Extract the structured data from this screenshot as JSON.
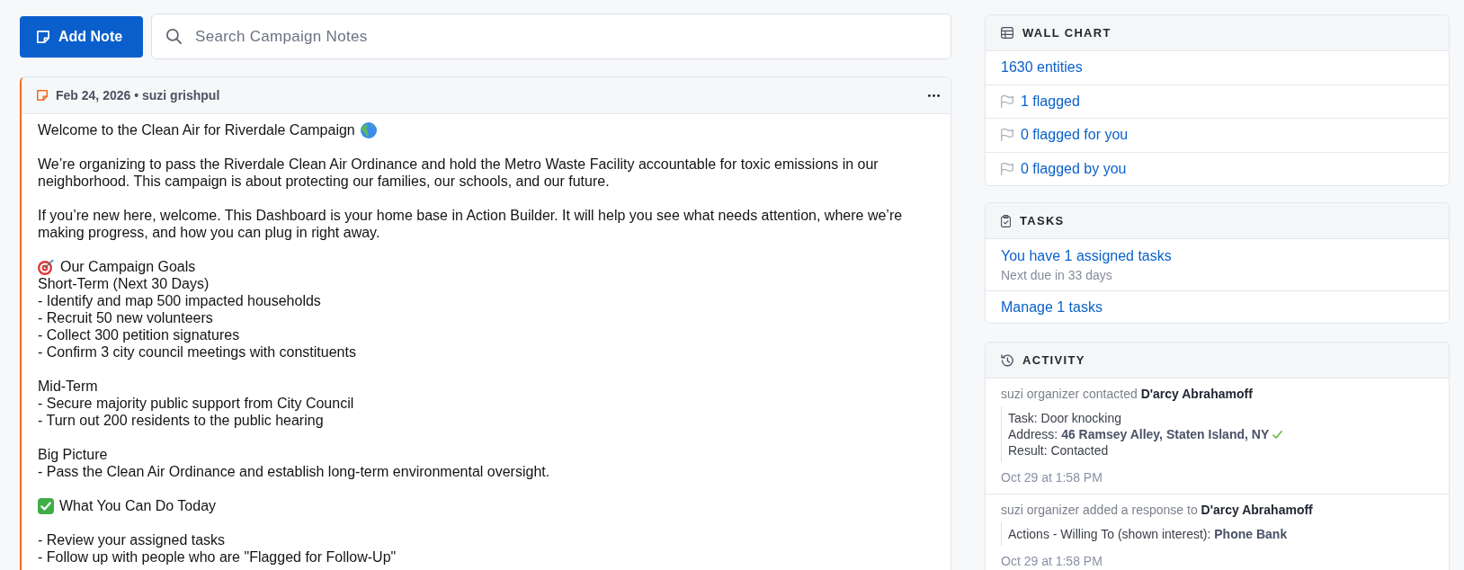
{
  "toolbar": {
    "add_button": "Add Note",
    "search": {
      "placeholder": "Search Campaign Notes"
    }
  },
  "note": {
    "meta": "Feb 24, 2026 • suzi grishpul",
    "blocks": [
      {
        "kind": "title",
        "lines": [
          "Welcome to the Clean Air for Riverdale Campaign"
        ]
      },
      {
        "kind": "text",
        "lines": [
          "We’re organizing to pass the Riverdale Clean Air Ordinance and hold the Metro Waste Facility accountable for toxic emissions in our neighborhood. This campaign is about protecting our families, our schools, and our future."
        ]
      },
      {
        "kind": "text",
        "lines": [
          "If you’re new here, welcome. This Dashboard is your home base in Action Builder. It will help you see what needs attention, where we’re making progress, and how you can plug in right away."
        ]
      },
      {
        "kind": "goals",
        "lines": [
          "Our Campaign Goals",
          "Short-Term (Next 30 Days)",
          "- Identify and map 500 impacted households",
          "- Recruit 50 new volunteers",
          "- Collect 300 petition signatures",
          "- Confirm 3 city council meetings with constituents"
        ]
      },
      {
        "kind": "text",
        "lines": [
          "Mid-Term",
          "- Secure majority public support from City Council",
          "- Turn out 200 residents to the public hearing"
        ]
      },
      {
        "kind": "text",
        "lines": [
          "Big Picture",
          "- Pass the Clean Air Ordinance and establish long-term environmental oversight."
        ]
      },
      {
        "kind": "todo",
        "lines": [
          "What You Can Do Today"
        ]
      },
      {
        "kind": "text",
        "lines": [
          "- Review your assigned tasks",
          "- Follow up with people who are \"Flagged for Follow-Up\""
        ]
      }
    ]
  },
  "wall_chart": {
    "title": "WALL CHART",
    "rows": [
      {
        "kind": "plain",
        "label": "1630 entities"
      },
      {
        "kind": "flag",
        "label": "1 flagged"
      },
      {
        "kind": "flag",
        "label": "0 flagged for you"
      },
      {
        "kind": "flag",
        "label": "0 flagged by you"
      }
    ]
  },
  "tasks": {
    "title": "TASKS",
    "items": [
      {
        "label": "You have 1 assigned tasks",
        "detail": "Next due in 33 days"
      },
      {
        "label": "Manage 1 tasks"
      }
    ]
  },
  "activity": {
    "title": "ACTIVITY",
    "items": [
      {
        "summary": "suzi organizer contacted **D'arcy Abrahamoff**",
        "details": [
          {
            "text": "Task: Door knocking",
            "verified": false
          },
          {
            "text": "Address: **46 Ramsey Alley, Staten Island, NY**",
            "verified": true
          },
          {
            "text": "Result: Contacted",
            "verified": false
          }
        ],
        "time": "Oct 29 at 1:58 PM"
      },
      {
        "summary": "suzi organizer added a response to **D'arcy Abrahamoff**",
        "details": [
          {
            "text": "Actions - Willing To (shown interest): **Phone Bank**",
            "verified": false
          }
        ],
        "time": "Oct 29 at 1:58 PM"
      }
    ]
  }
}
